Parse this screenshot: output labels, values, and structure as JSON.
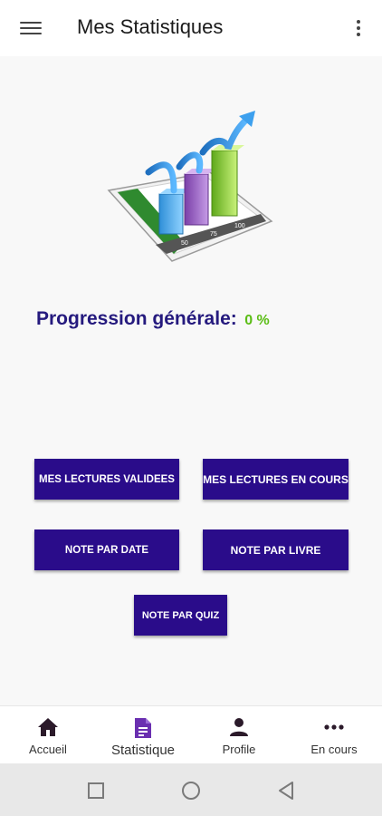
{
  "appbar": {
    "title": "Mes Statistiques",
    "menu_icon": "hamburger-menu-icon",
    "overflow_icon": "more-vert-icon"
  },
  "hero": {
    "icon": "bar-chart-growth-illustration",
    "axis_ticks": [
      "50",
      "75",
      "100"
    ]
  },
  "progress": {
    "label": "Progression générale:",
    "value": "0 %"
  },
  "buttons": {
    "validated_reads": "MES LECTURES VALIDEES",
    "current_reads": "MES LECTURES EN COURS",
    "score_by_date": "NOTE PAR DATE",
    "score_by_book": "NOTE PAR LIVRE",
    "score_by_quiz": "NOTE PAR QUIZ"
  },
  "bottom_nav": {
    "items": [
      {
        "label": "Accueil",
        "icon": "home-icon"
      },
      {
        "label": "Statistique",
        "icon": "document-icon",
        "active": true
      },
      {
        "label": "Profile",
        "icon": "person-icon"
      },
      {
        "label": "En cours",
        "icon": "more-horiz-icon"
      }
    ]
  },
  "colors": {
    "primary": "#2a0c8a",
    "accent_green": "#5bbd16",
    "title_blue": "#251a7e"
  }
}
